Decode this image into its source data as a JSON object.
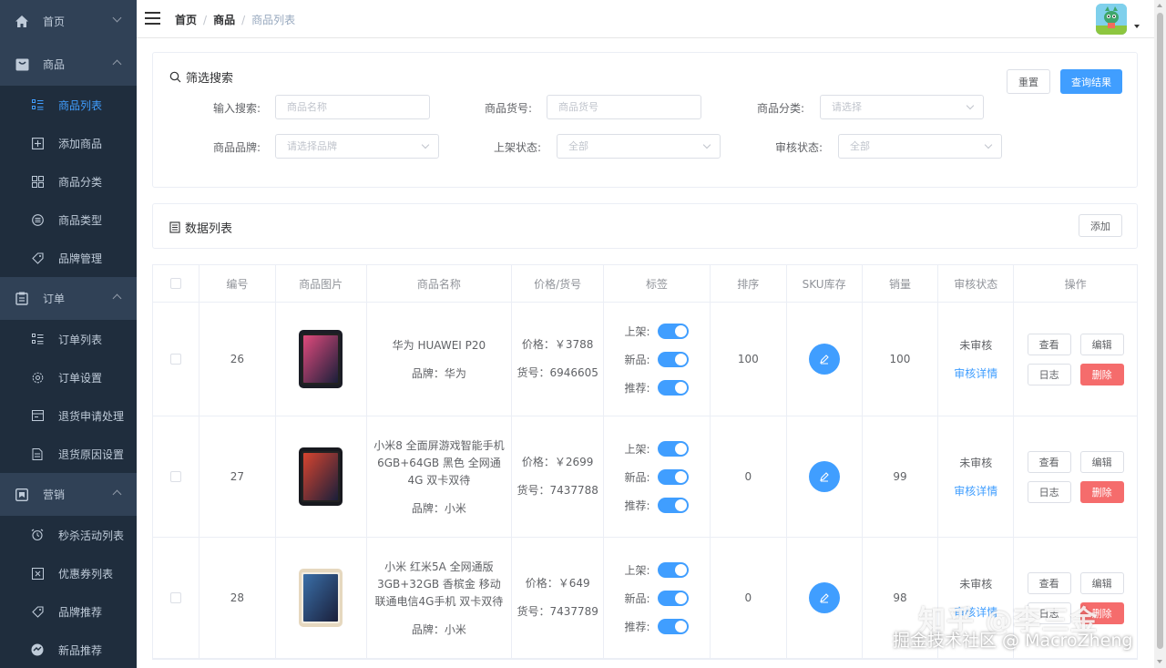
{
  "sidebar": {
    "groups": [
      {
        "label": "首页",
        "icon": "home-icon",
        "expanded": false
      },
      {
        "label": "商品",
        "icon": "product-icon",
        "expanded": true,
        "items": [
          {
            "label": "商品列表",
            "icon": "list-icon",
            "active": true
          },
          {
            "label": "添加商品",
            "icon": "add-square-icon"
          },
          {
            "label": "商品分类",
            "icon": "grid-icon"
          },
          {
            "label": "商品类型",
            "icon": "circle-list-icon"
          },
          {
            "label": "品牌管理",
            "icon": "tag-icon"
          }
        ]
      },
      {
        "label": "订单",
        "icon": "order-icon",
        "expanded": true,
        "items": [
          {
            "label": "订单列表",
            "icon": "list-icon"
          },
          {
            "label": "订单设置",
            "icon": "gear-icon"
          },
          {
            "label": "退货申请处理",
            "icon": "return-icon"
          },
          {
            "label": "退货原因设置",
            "icon": "document-icon"
          }
        ]
      },
      {
        "label": "营销",
        "icon": "marketing-icon",
        "expanded": true,
        "items": [
          {
            "label": "秒杀活动列表",
            "icon": "alarm-icon"
          },
          {
            "label": "优惠券列表",
            "icon": "coupon-icon"
          },
          {
            "label": "品牌推荐",
            "icon": "tag-icon"
          },
          {
            "label": "新品推荐",
            "icon": "new-icon"
          }
        ]
      }
    ]
  },
  "header": {
    "breadcrumb": [
      "首页",
      "商品",
      "商品列表"
    ]
  },
  "filter": {
    "title": "筛选搜索",
    "reset_label": "重置",
    "query_label": "查询结果",
    "fields": {
      "keyword": {
        "label": "输入搜索:",
        "placeholder": "商品名称"
      },
      "sn": {
        "label": "商品货号:",
        "placeholder": "商品货号"
      },
      "category": {
        "label": "商品分类:",
        "placeholder": "请选择"
      },
      "brand": {
        "label": "商品品牌:",
        "placeholder": "请选择品牌"
      },
      "publish": {
        "label": "上架状态:",
        "placeholder": "全部"
      },
      "verify": {
        "label": "审核状态:",
        "placeholder": "全部"
      }
    }
  },
  "list": {
    "title": "数据列表",
    "add_label": "添加"
  },
  "table": {
    "headers": [
      "编号",
      "商品图片",
      "商品名称",
      "价格/货号",
      "标签",
      "排序",
      "SKU库存",
      "销量",
      "审核状态",
      "操作"
    ],
    "tag_labels": [
      "上架:",
      "新品:",
      "推荐:"
    ],
    "op_labels": {
      "view": "查看",
      "edit": "编辑",
      "log": "日志",
      "delete": "删除"
    },
    "rows": [
      {
        "id": "26",
        "name": "华为 HUAWEI P20",
        "brand": "品牌：华为",
        "price": "价格：￥3788",
        "sn": "货号：6946605",
        "sort": "100",
        "sale": "100",
        "status": "未审核",
        "detail": "审核详情",
        "img_color": "#1b1d26",
        "img_accent": "#e04a7c"
      },
      {
        "id": "27",
        "name": "小米8 全面屏游戏智能手机 6GB+64GB 黑色 全网通4G 双卡双待",
        "brand": "品牌：小米",
        "price": "价格：￥2699",
        "sn": "货号：7437788",
        "sort": "0",
        "sale": "99",
        "status": "未审核",
        "detail": "审核详情",
        "img_color": "#18191f",
        "img_accent": "#d7442f"
      },
      {
        "id": "28",
        "name": "小米 红米5A 全网通版 3GB+32GB 香槟金 移动联通电信4G手机 双卡双待",
        "brand": "品牌：小米",
        "price": "价格：￥649",
        "sn": "货号：7437789",
        "sort": "0",
        "sale": "98",
        "status": "未审核",
        "detail": "审核详情",
        "img_color": "#e6d8bf",
        "img_accent": "#3a6fa8"
      }
    ]
  },
  "watermark": {
    "line1": "知乎 @李三金",
    "line2": "掘金技术社区 @ MacroZheng"
  }
}
